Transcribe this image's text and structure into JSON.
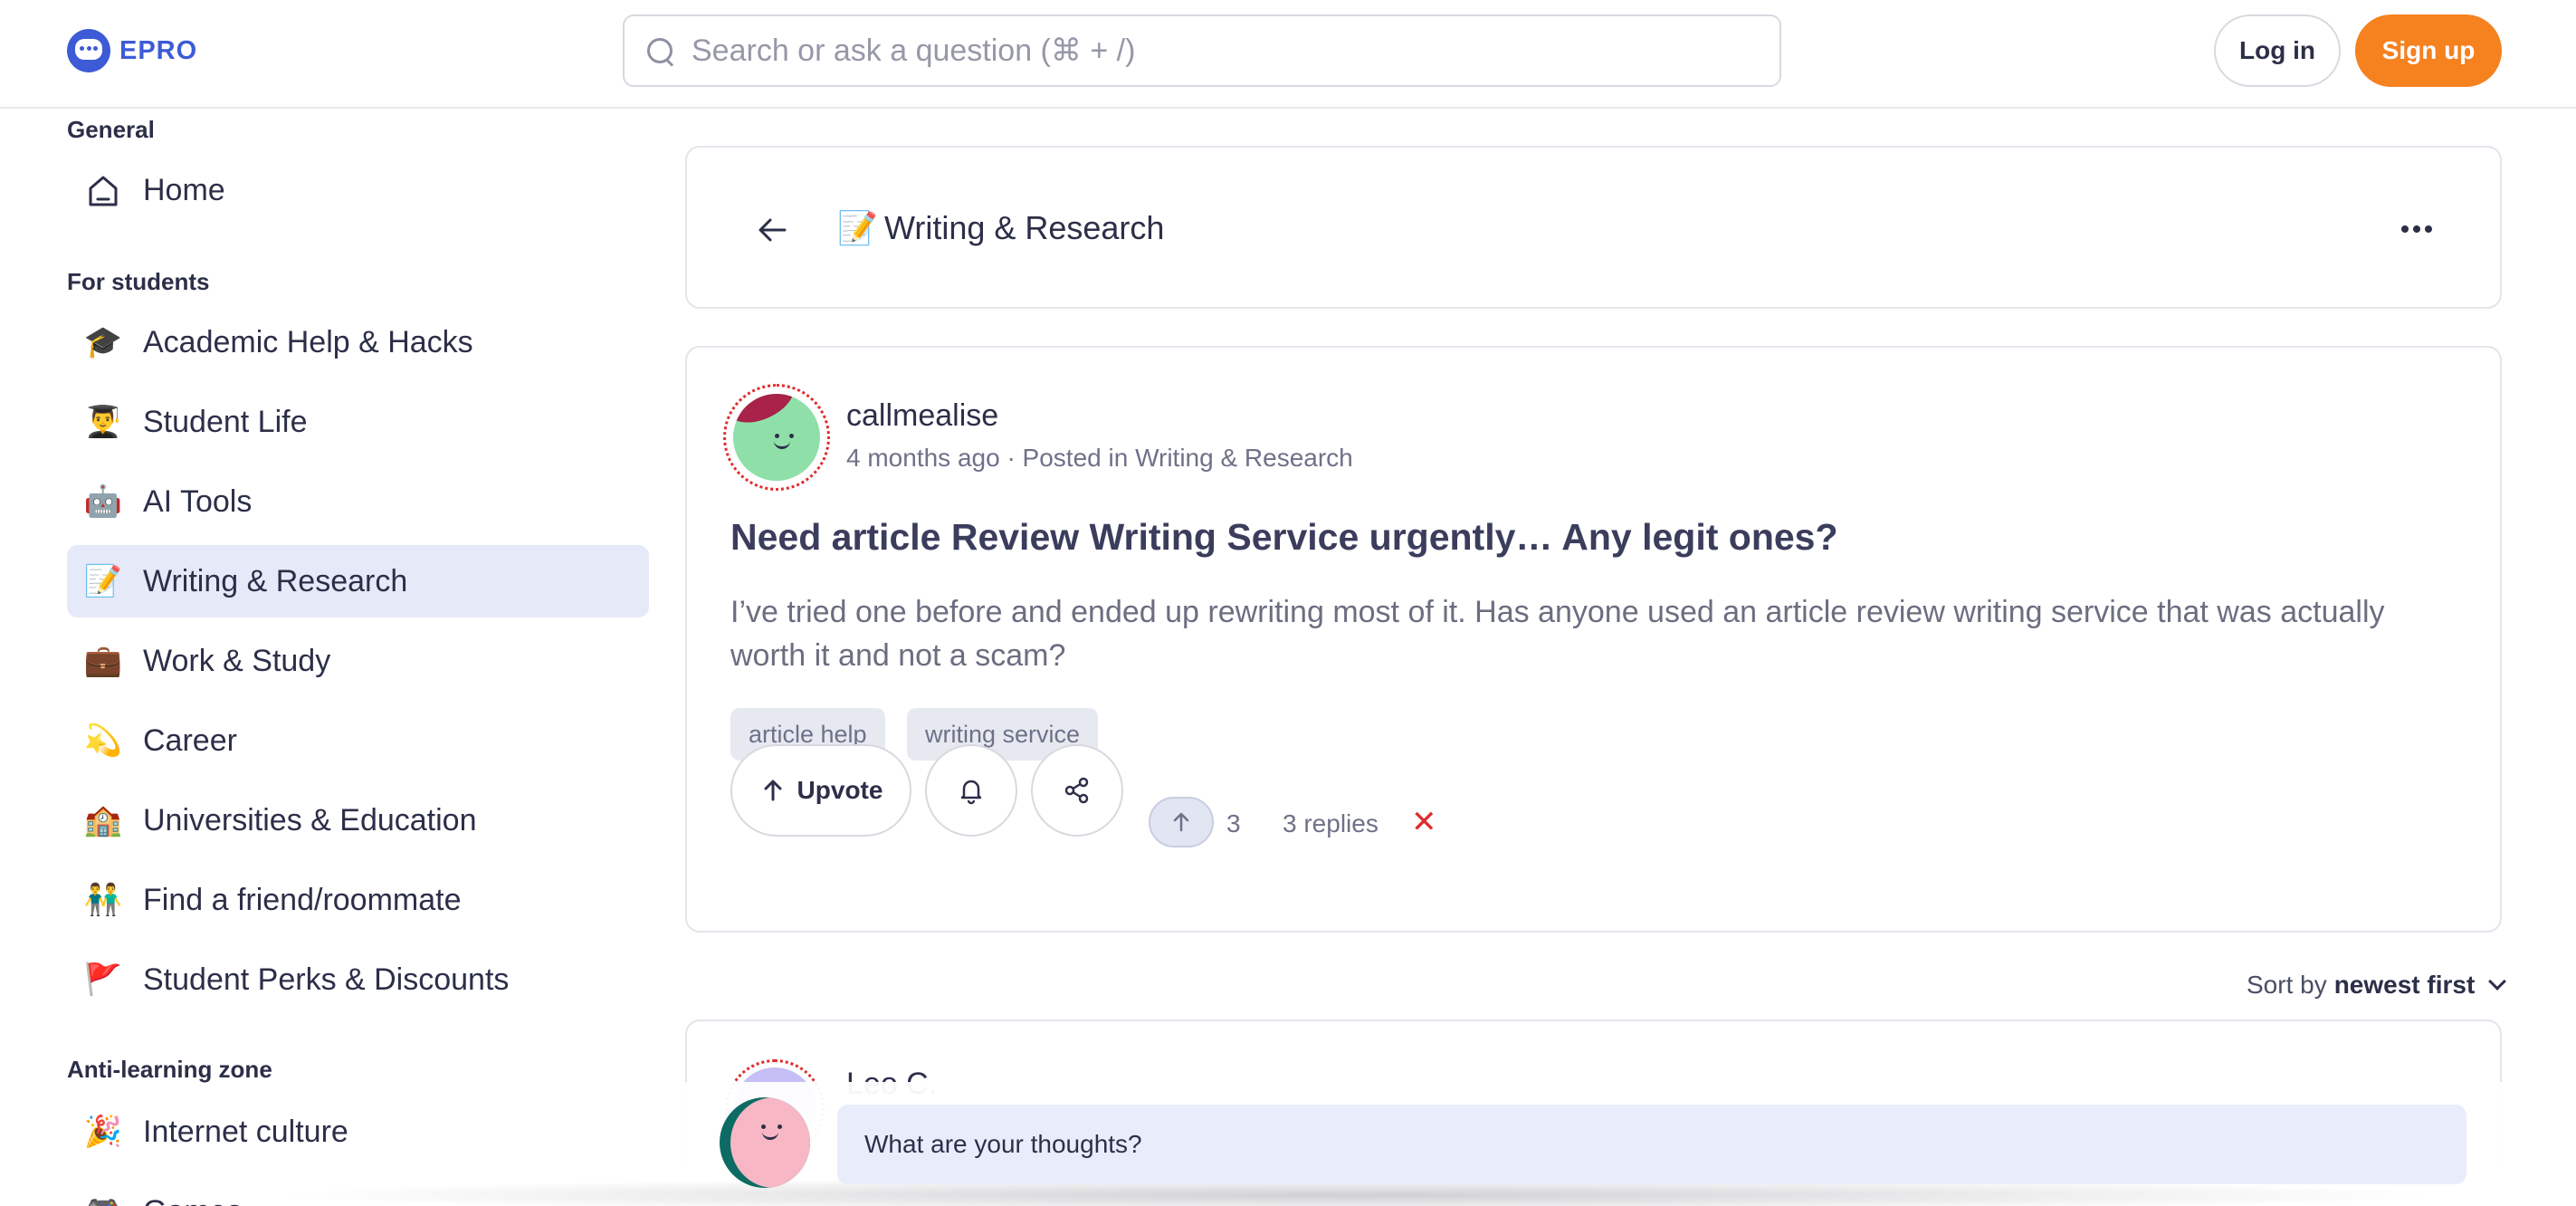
{
  "header": {
    "brand": "EPRO",
    "search_placeholder": "Search or ask a question (⌘ + /)",
    "login_label": "Log in",
    "signup_label": "Sign up",
    "colors": {
      "brand": "#3d5bd6",
      "signup": "#f5811f"
    }
  },
  "sidebar": {
    "sections": [
      {
        "label": "General"
      },
      {
        "label": "For students"
      },
      {
        "label": "Anti-learning zone"
      }
    ],
    "items": [
      {
        "emoji": "",
        "icon": "home-icon",
        "label": "Home"
      },
      {
        "emoji": "🎓",
        "icon": "graduation-cap-icon",
        "label": "Academic Help & Hacks"
      },
      {
        "emoji": "👨‍🎓",
        "icon": "student-icon",
        "label": "Student Life"
      },
      {
        "emoji": "🤖",
        "icon": "robot-icon",
        "label": "AI Tools"
      },
      {
        "emoji": "📝",
        "icon": "memo-icon",
        "label": "Writing & Research"
      },
      {
        "emoji": "💼",
        "icon": "briefcase-icon",
        "label": "Work & Study"
      },
      {
        "emoji": "💫",
        "icon": "dizzy-star-icon",
        "label": "Career"
      },
      {
        "emoji": "🏫",
        "icon": "school-icon",
        "label": "Universities & Education"
      },
      {
        "emoji": "👬",
        "icon": "friends-icon",
        "label": "Find a friend/roommate"
      },
      {
        "emoji": "🚩",
        "icon": "flag-icon",
        "label": "Student Perks & Discounts"
      },
      {
        "emoji": "🎉",
        "icon": "party-popper-icon",
        "label": "Internet culture"
      },
      {
        "emoji": "🎮",
        "icon": "game-controller-icon",
        "label": "Games"
      }
    ],
    "active_item": "Writing & Research"
  },
  "topic": {
    "emoji": "📝",
    "title": "Writing & Research"
  },
  "post": {
    "author": "callmealise",
    "meta": "4 months ago · Posted in Writing & Research",
    "title": "Need article Review Writing Service urgently… Any legit ones?",
    "body": "I’ve tried one before and ended up rewriting most of it. Has anyone used an article review writing service that was actually worth it and not a scam?",
    "tags": [
      "article help",
      "writing service"
    ],
    "upvote_label": "Upvote",
    "vote_count": "3",
    "replies": "3 replies",
    "dismiss": "✕"
  },
  "sort": {
    "prefix": "Sort by",
    "value": "newest first"
  },
  "reply": {
    "author": "Leo C."
  },
  "composer": {
    "placeholder": "What are your thoughts?"
  }
}
